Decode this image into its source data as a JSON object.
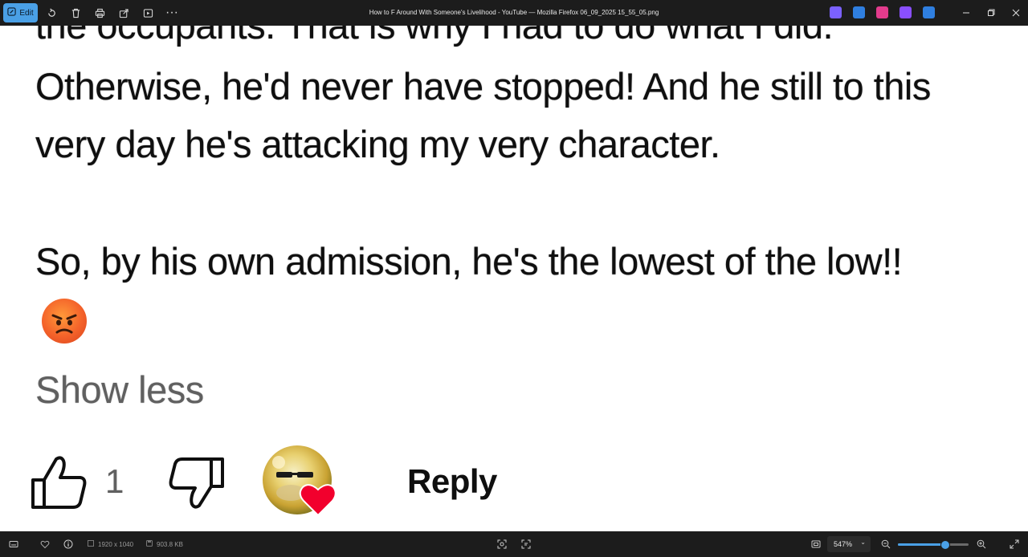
{
  "window": {
    "title": "How to F Around With Someone's Livelihood - YouTube — Mozilla Firefox 06_09_2025 15_55_05.png"
  },
  "toolbar": {
    "edit_label": "Edit",
    "more_label": "···",
    "tools": [
      "rotate-icon",
      "delete-icon",
      "print-icon",
      "share-icon",
      "slideshow-icon"
    ],
    "app_icons": [
      {
        "name": "copilot-icon",
        "color": "#7b61ff"
      },
      {
        "name": "photos-app-icon",
        "color": "#2f7fe0"
      },
      {
        "name": "clipchamp-icon",
        "color": "#e23b8c"
      },
      {
        "name": "video-editor-icon",
        "color": "#8a4fff"
      },
      {
        "name": "onedrive-icon",
        "color": "#2f7fe0"
      }
    ]
  },
  "comment": {
    "partial_top_line": "the occupants. That is why I had to do what I did.",
    "lines": [
      "Otherwise, he'd never have stopped! And he still to this",
      "very day he's attacking my very character.",
      "So, by his own admission, he's the lowest of the low!!"
    ],
    "emoji": "angry-face",
    "show_less_label": "Show less",
    "like_count": "1",
    "reply_label": "Reply",
    "heart_color": "#f2002d"
  },
  "status_bar": {
    "dimensions": "1920 x 1040",
    "file_size": "903.8 KB",
    "zoom_level": "547%",
    "zoom_fraction": 0.66,
    "accent_color": "#4aa0e6"
  }
}
